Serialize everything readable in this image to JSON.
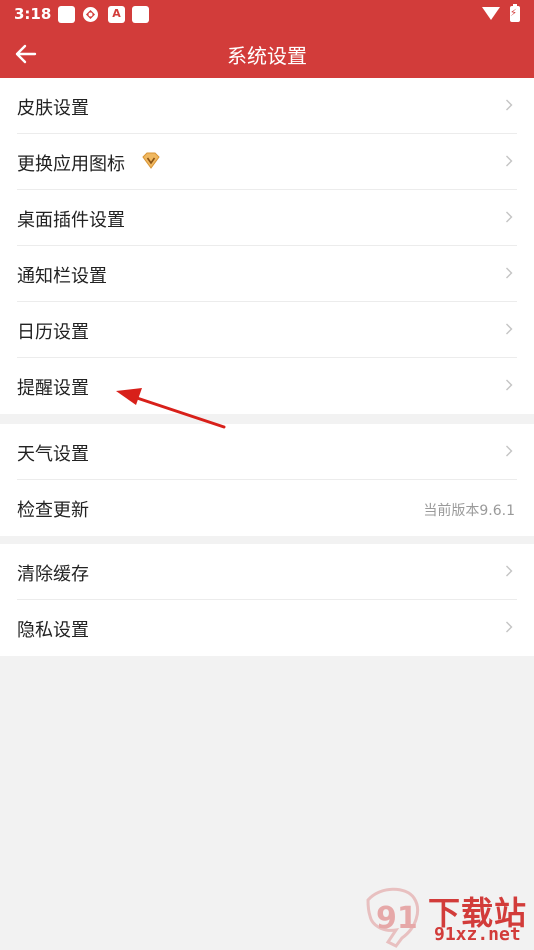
{
  "status_bar": {
    "time": "3:18",
    "icons": [
      "square-icon",
      "cast-icon",
      "a-icon",
      "square-icon",
      "wifi-icon",
      "battery-charging-icon"
    ]
  },
  "app_bar": {
    "title": "系统设置",
    "back_icon": "arrow-left-icon"
  },
  "colors": {
    "brand_red": "#d23c3a",
    "vip_gold": "#e6a44a"
  },
  "sections": [
    {
      "items": [
        {
          "label": "皮肤设置"
        },
        {
          "label": "更换应用图标",
          "badge_icon": "vip-diamond-icon"
        },
        {
          "label": "桌面插件设置"
        },
        {
          "label": "通知栏设置"
        },
        {
          "label": "日历设置"
        },
        {
          "label": "提醒设置"
        }
      ]
    },
    {
      "items": [
        {
          "label": "天气设置"
        },
        {
          "label": "检查更新",
          "value": "当前版本9.6.1"
        }
      ]
    },
    {
      "items": [
        {
          "label": "清除缓存"
        },
        {
          "label": "隐私设置"
        }
      ]
    }
  ],
  "watermark": {
    "line1": "下载站",
    "line2": "91xz.net"
  }
}
